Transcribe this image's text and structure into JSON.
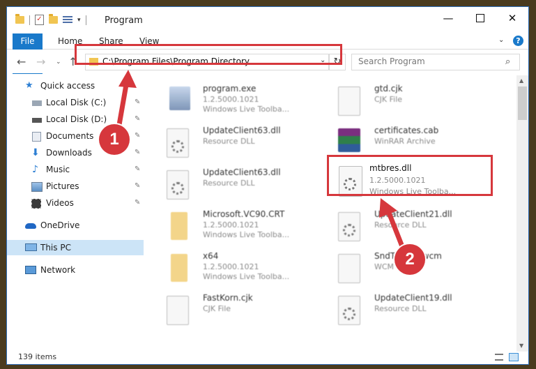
{
  "window": {
    "title": "Program",
    "min_glyph": "—",
    "close_glyph": "✕"
  },
  "ribbon": {
    "tabs": [
      {
        "label": "File"
      },
      {
        "label": "Home"
      },
      {
        "label": "Share"
      },
      {
        "label": "View"
      }
    ],
    "help": "?"
  },
  "navbar": {
    "back": "←",
    "forward": "→",
    "recent": "⌄",
    "up": "↑",
    "address": "C:\\Program Files\\Program Directory",
    "address_dropdown": "⌄",
    "refresh": "↻",
    "search_placeholder": "Search Program",
    "search_glyph": "⌕"
  },
  "sidebar": {
    "items": [
      {
        "label": "Quick access",
        "icon": "star-icon"
      },
      {
        "label": "Local Disk (C:)",
        "icon": "drive-icon",
        "pinned": true
      },
      {
        "label": "Local Disk (D:)",
        "icon": "drive-icon",
        "pinned": true
      },
      {
        "label": "Documents",
        "icon": "documents-icon",
        "pinned": true
      },
      {
        "label": "Downloads",
        "icon": "download-icon",
        "pinned": true
      },
      {
        "label": "Music",
        "icon": "music-icon",
        "pinned": true
      },
      {
        "label": "Pictures",
        "icon": "pictures-icon",
        "pinned": true
      },
      {
        "label": "Videos",
        "icon": "videos-icon",
        "pinned": true
      },
      {
        "label": "OneDrive",
        "icon": "cloud-icon"
      },
      {
        "label": "This PC",
        "icon": "computer-icon",
        "selected": true
      },
      {
        "label": "Network",
        "icon": "network-icon"
      }
    ],
    "pin_glyph": "📌"
  },
  "files": [
    {
      "name": "program.exe",
      "line1": "1.2.5000.1021",
      "line2": "Windows Live Toolba...",
      "icon": "exe-icon"
    },
    {
      "name": "gtd.cjk",
      "line1": "CJK File",
      "line2": "",
      "icon": "document-icon"
    },
    {
      "name": "UpdateClient63.dll",
      "line1": "Resource DLL",
      "line2": "",
      "icon": "dll-icon"
    },
    {
      "name": "certificates.cab",
      "line1": "WinRAR Archive",
      "line2": "",
      "icon": "rar-icon"
    },
    {
      "name": "UpdateClient63.dll",
      "line1": "Resource DLL",
      "line2": "",
      "icon": "dll-icon"
    },
    {
      "name": "mtbres.dll",
      "line1": "1.2.5000.1021",
      "line2": "Windows Live Toolba...",
      "icon": "dll-icon",
      "highlighted": true
    },
    {
      "name": "Microsoft.VC90.CRT",
      "line1": "1.2.5000.1021",
      "line2": "Windows Live Toolba...",
      "icon": "folder-icon"
    },
    {
      "name": "UpdateClient21.dll",
      "line1": "Resource DLL",
      "line2": "",
      "icon": "dll-icon"
    },
    {
      "name": "x64",
      "line1": "1.2.5000.1021",
      "line2": "Windows Live Toolba...",
      "icon": "folder-icon"
    },
    {
      "name": "SndToolbar.wcm",
      "line1": "WCM File",
      "line2": "",
      "icon": "document-icon"
    },
    {
      "name": "FastKorn.cjk",
      "line1": "CJK File",
      "line2": "",
      "icon": "document-icon"
    },
    {
      "name": "UpdateClient19.dll",
      "line1": "Resource DLL",
      "line2": "",
      "icon": "dll-icon"
    }
  ],
  "status": {
    "item_count": "139 items"
  },
  "callouts": {
    "one": "1",
    "two": "2"
  },
  "colors": {
    "accent": "#1979ca",
    "highlight_red": "#d6373c",
    "selected_bg": "#cce4f7"
  }
}
